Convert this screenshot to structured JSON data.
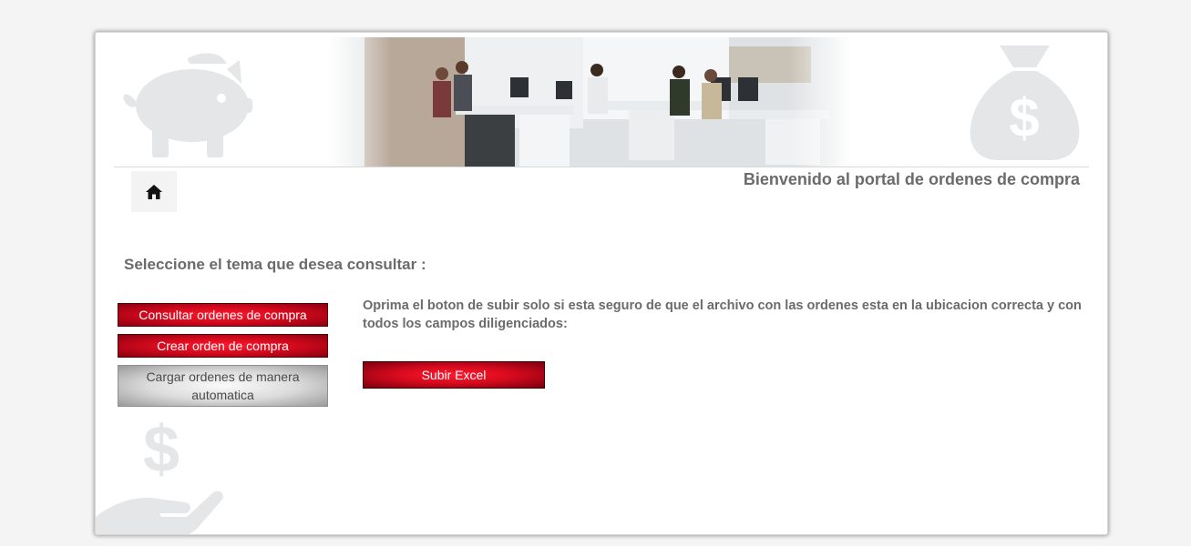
{
  "header": {
    "welcome_text": "Bienvenido al portal de ordenes de compra",
    "home_icon": "home-icon"
  },
  "main": {
    "section_title": "Seleccione el tema que desea consultar :",
    "instructions": "Oprima el boton de subir solo si esta seguro de que el archivo con las ordenes esta en la ubicacion correcta y con todos los campos diligenciados:",
    "upload_label": "Subir Excel"
  },
  "sidebar": {
    "items": [
      {
        "label": "Consultar ordenes de compra"
      },
      {
        "label": "Crear orden de compra"
      },
      {
        "label": "Cargar ordenes de manera automatica"
      }
    ]
  },
  "decor": {
    "icons": [
      "piggy-bank-icon",
      "money-bag-icon",
      "hand-money-icon"
    ],
    "icon_color": "#e4e6e8"
  },
  "colors": {
    "accent": "#d80a1e",
    "accent_dark": "#8a0010",
    "text": "#6b6b6b",
    "background": "#f4f4f4"
  }
}
